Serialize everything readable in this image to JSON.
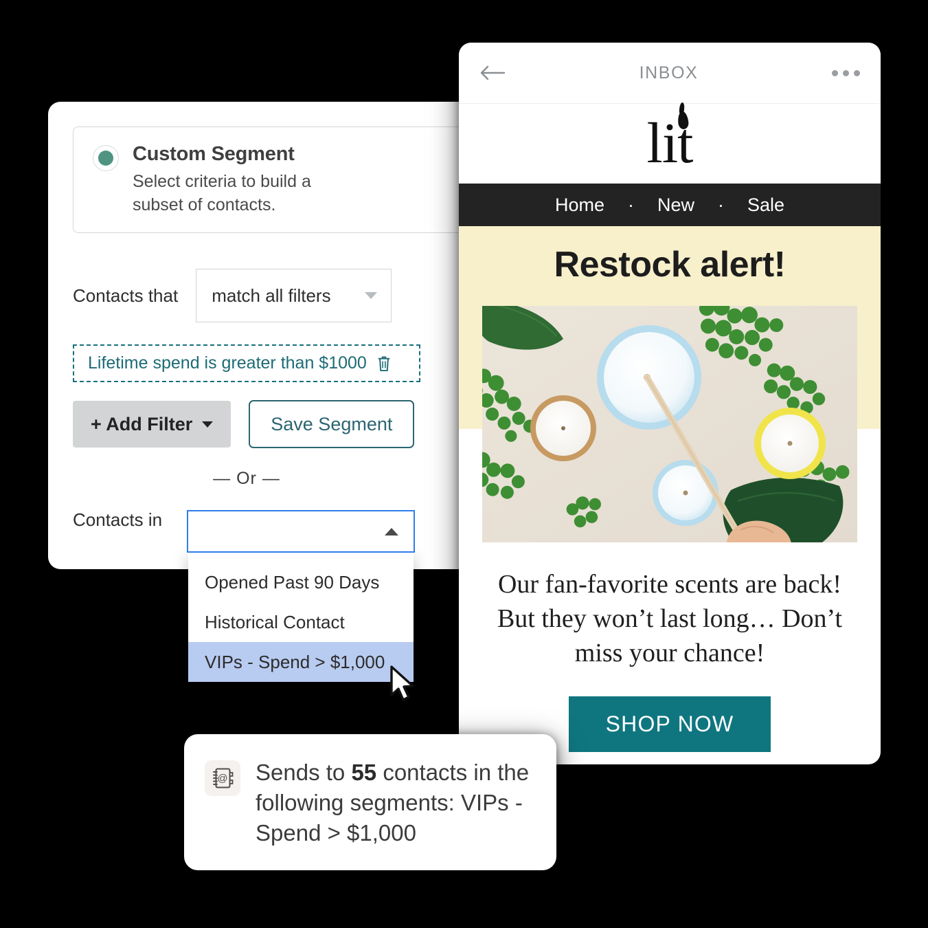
{
  "segment_builder": {
    "option": {
      "title": "Custom Segment",
      "subtitle": "Select criteria to build a subset of contacts.",
      "radio_icon": "radio-selected-icon",
      "selected": true,
      "accent_color": "#4f9481"
    },
    "match_row": {
      "label": "Contacts that",
      "select_value": "match all filters",
      "caret_icon": "chevron-down-icon"
    },
    "filter_chip": {
      "text": "Lifetime spend is greater than $1000",
      "delete_icon": "trash-icon",
      "border_color": "#16707e"
    },
    "buttons": {
      "add_filter": "+ Add Filter",
      "add_filter_caret_icon": "chevron-down-icon",
      "save_segment": "Save Segment",
      "save_color": "#2c6571"
    },
    "or_divider": "— Or —",
    "contacts_in": {
      "label": "Contacts in",
      "select_value": "",
      "caret_icon": "chevron-up-icon",
      "focus_color": "#2e7dea",
      "options": [
        {
          "label": "Opened Past 90 Days",
          "selected": false
        },
        {
          "label": "Historical Contact",
          "selected": false
        },
        {
          "label": "VIPs - Spend > $1,000",
          "selected": true
        }
      ],
      "highlight_color": "#b8cbf0"
    },
    "cursor_icon": "mouse-pointer-icon"
  },
  "email_preview": {
    "header": {
      "back_icon": "arrow-left-icon",
      "title": "INBOX",
      "more_icon": "ellipsis-icon"
    },
    "brand": {
      "logo_text": "lit",
      "flame_icon": "flame-icon"
    },
    "nav": {
      "items": [
        "Home",
        "New",
        "Sale"
      ],
      "separator": "·",
      "background": "#232323"
    },
    "alert": {
      "headline": "Restock alert!",
      "background": "#f7f0cb"
    },
    "hero_image": {
      "alt": "candles-flat-lay-photo"
    },
    "body_text": "Our fan-favorite scents are back! But they won’t last long… Don’t miss your chance!",
    "cta": {
      "label": "SHOP NOW",
      "background": "#0f7680"
    }
  },
  "sends_card": {
    "icon": "address-book-icon",
    "prefix": "Sends to ",
    "count": "55",
    "middle": " contacts in the following segments: ",
    "segment": "VIPs - Spend > $1,000",
    "full_text": "Sends to 55 contacts in the following segments: VIPs - Spend > $1,000"
  }
}
